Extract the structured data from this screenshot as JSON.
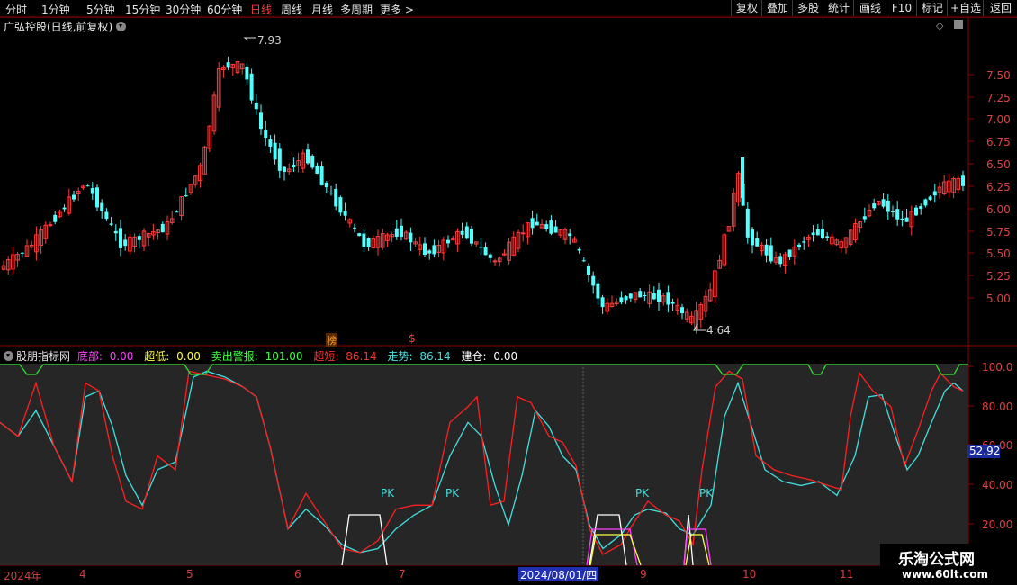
{
  "toolbar": {
    "periods": [
      "分时",
      "1分钟",
      "5分钟",
      "15分钟",
      "30分钟",
      "60分钟",
      "日线",
      "周线",
      "月线",
      "多周期",
      "更多"
    ],
    "active_period": "日线",
    "right_buttons": [
      "复权",
      "叠加",
      "多股",
      "统计",
      "画线",
      "F10",
      "标记",
      "+自选",
      "返回"
    ]
  },
  "stock": {
    "title": "广弘控股(日线,前复权)"
  },
  "price_axis": [
    "7.50",
    "7.25",
    "7.00",
    "6.75",
    "6.50",
    "6.25",
    "6.00",
    "5.75",
    "5.50",
    "5.25",
    "5.00"
  ],
  "price_marks": {
    "high": "7.93",
    "low": "4.64"
  },
  "badges": {
    "bang": "榜",
    "dollar": "$"
  },
  "indicator": {
    "name": "股朋指标网",
    "items": [
      {
        "label": "底部:",
        "value": "0.00",
        "color": "#ff40ff"
      },
      {
        "label": "超低:",
        "value": "0.00",
        "color": "#ffff40"
      },
      {
        "label": "卖出警报:",
        "value": "101.00",
        "color": "#40ff40"
      },
      {
        "label": "超短:",
        "value": "86.14",
        "color": "#ff3030"
      },
      {
        "label": "走势:",
        "value": "86.14",
        "color": "#40e0e0"
      },
      {
        "label": "建仓:",
        "value": "0.00",
        "color": "#ffffff"
      }
    ],
    "axis": [
      "100.0",
      "80.00",
      "60.00",
      "40.00",
      "20.00"
    ],
    "current": "52.92",
    "pk_labels": [
      "PK",
      "PK",
      "PK",
      "PK"
    ]
  },
  "dates": {
    "labels": [
      "2024年",
      "4",
      "5",
      "6",
      "7",
      "9",
      "10",
      "11"
    ],
    "cursor": "2024/08/01/四"
  },
  "watermark": {
    "line1": "乐淘公式网",
    "line2": "www.60lt.com"
  },
  "colors": {
    "up": "#ff3c3c",
    "down": "#54ffff",
    "grid": "#8b0000"
  }
}
